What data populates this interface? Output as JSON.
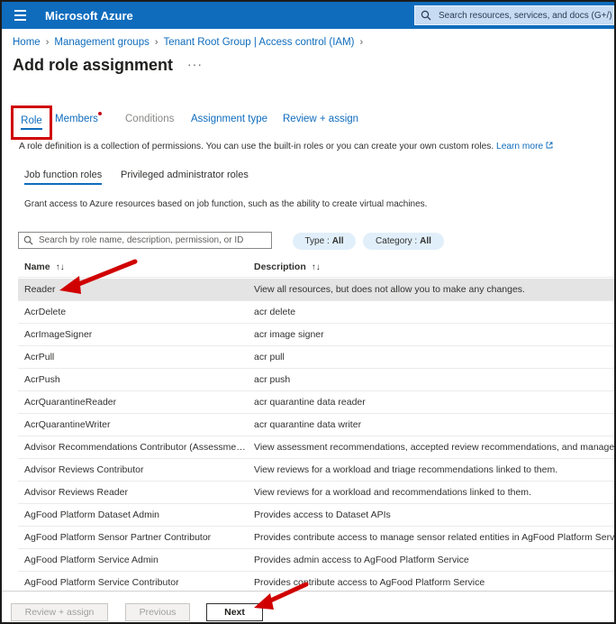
{
  "topbar": {
    "brand": "Microsoft Azure",
    "search_placeholder": "Search resources, services, and docs (G+/)",
    "accent": "#0f6cbd"
  },
  "breadcrumb": {
    "items": [
      "Home",
      "Management groups",
      "Tenant Root Group | Access control (IAM)"
    ]
  },
  "page": {
    "title": "Add role assignment",
    "more": "···"
  },
  "tabs": [
    {
      "label": "Role",
      "active": true
    },
    {
      "label": "Members",
      "required_dot": true
    },
    {
      "label": "Conditions",
      "disabled": true
    },
    {
      "label": "Assignment type"
    },
    {
      "label": "Review + assign"
    }
  ],
  "description": {
    "text": "A role definition is a collection of permissions. You can use the built-in roles or you can create your own custom roles.",
    "link": "Learn more"
  },
  "subtabs": [
    "Job function roles",
    "Privileged administrator roles"
  ],
  "helper_text": "Grant access to Azure resources based on job function, such as the ability to create virtual machines.",
  "filters": {
    "search_placeholder": "Search by role name, description, permission, or ID",
    "type_label": "Type :",
    "type_value": "All",
    "category_label": "Category :",
    "category_value": "All"
  },
  "table": {
    "headers": {
      "name": "Name",
      "description": "Description",
      "sort_glyph": "↑↓"
    },
    "rows": [
      {
        "name": "Reader",
        "description": "View all resources, but does not allow you to make any changes.",
        "selected": true
      },
      {
        "name": "AcrDelete",
        "description": "acr delete"
      },
      {
        "name": "AcrImageSigner",
        "description": "acr image signer"
      },
      {
        "name": "AcrPull",
        "description": "acr pull"
      },
      {
        "name": "AcrPush",
        "description": "acr push"
      },
      {
        "name": "AcrQuarantineReader",
        "description": "acr quarantine data reader"
      },
      {
        "name": "AcrQuarantineWriter",
        "description": "acr quarantine data writer"
      },
      {
        "name": "Advisor Recommendations Contributor (Assessments ...",
        "description": "View assessment recommendations, accepted review recommendations, and manage the r"
      },
      {
        "name": "Advisor Reviews Contributor",
        "description": "View reviews for a workload and triage recommendations linked to them."
      },
      {
        "name": "Advisor Reviews Reader",
        "description": "View reviews for a workload and recommendations linked to them."
      },
      {
        "name": "AgFood Platform Dataset Admin",
        "description": "Provides access to Dataset APIs"
      },
      {
        "name": "AgFood Platform Sensor Partner Contributor",
        "description": "Provides contribute access to manage sensor related entities in AgFood Platform Service"
      },
      {
        "name": "AgFood Platform Service Admin",
        "description": "Provides admin access to AgFood Platform Service"
      },
      {
        "name": "AgFood Platform Service Contributor",
        "description": "Provides contribute access to AgFood Platform Service"
      }
    ]
  },
  "footer": {
    "review_assign": "Review + assign",
    "previous": "Previous",
    "next": "Next"
  },
  "annotations": {
    "highlight_color": "#d00000"
  }
}
